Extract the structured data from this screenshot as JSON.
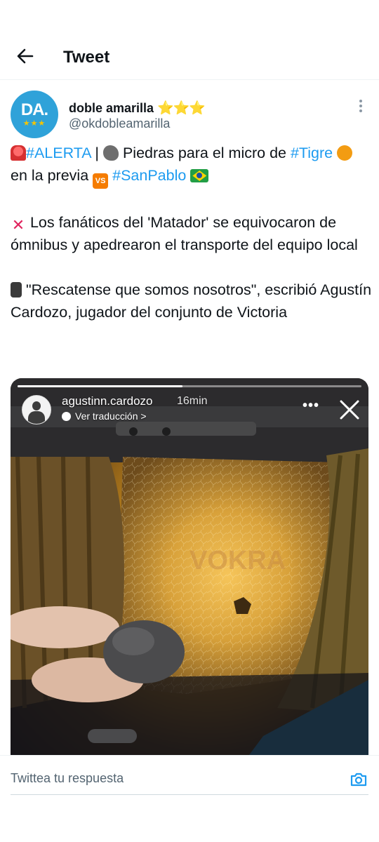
{
  "header": {
    "title": "Tweet"
  },
  "author": {
    "avatar_text": "DA.",
    "avatar_stars": "★★★",
    "name": "doble amarilla",
    "name_stars": "⭐⭐⭐",
    "handle": "@okdobleamarilla"
  },
  "tweet": {
    "p1": {
      "hashtag_alert": "#ALERTA",
      "sep": " | ",
      "text1": " Piedras para el micro de",
      "hashtag_tigre": "#Tigre",
      "text2": " en la previa ",
      "vs": "VS",
      "hashtag_sanpablo": "#SanPablo"
    },
    "p2": {
      "cross": "✕",
      "text": " Los fanáticos del 'Matador' se equivocaron de ómnibus y apedrearon el transporte del equipo local"
    },
    "p3": {
      "text": " \"Rescatense que somos nosotros\", escribió Agustín Cardozo, jugador del conjunto de Victoria"
    }
  },
  "story": {
    "username": "agustinn.cardozo",
    "time": "16min",
    "translate": "Ver traducción",
    "translate_arrow": " >",
    "more": "•••",
    "progress": 0.48,
    "watermark": "VOKRA"
  },
  "reply": {
    "placeholder": "Twittea tu respuesta"
  },
  "colors": {
    "link": "#1d9bf0",
    "avatar_bg": "#2fa2d9",
    "text": "#0f1419",
    "muted": "#536471"
  }
}
